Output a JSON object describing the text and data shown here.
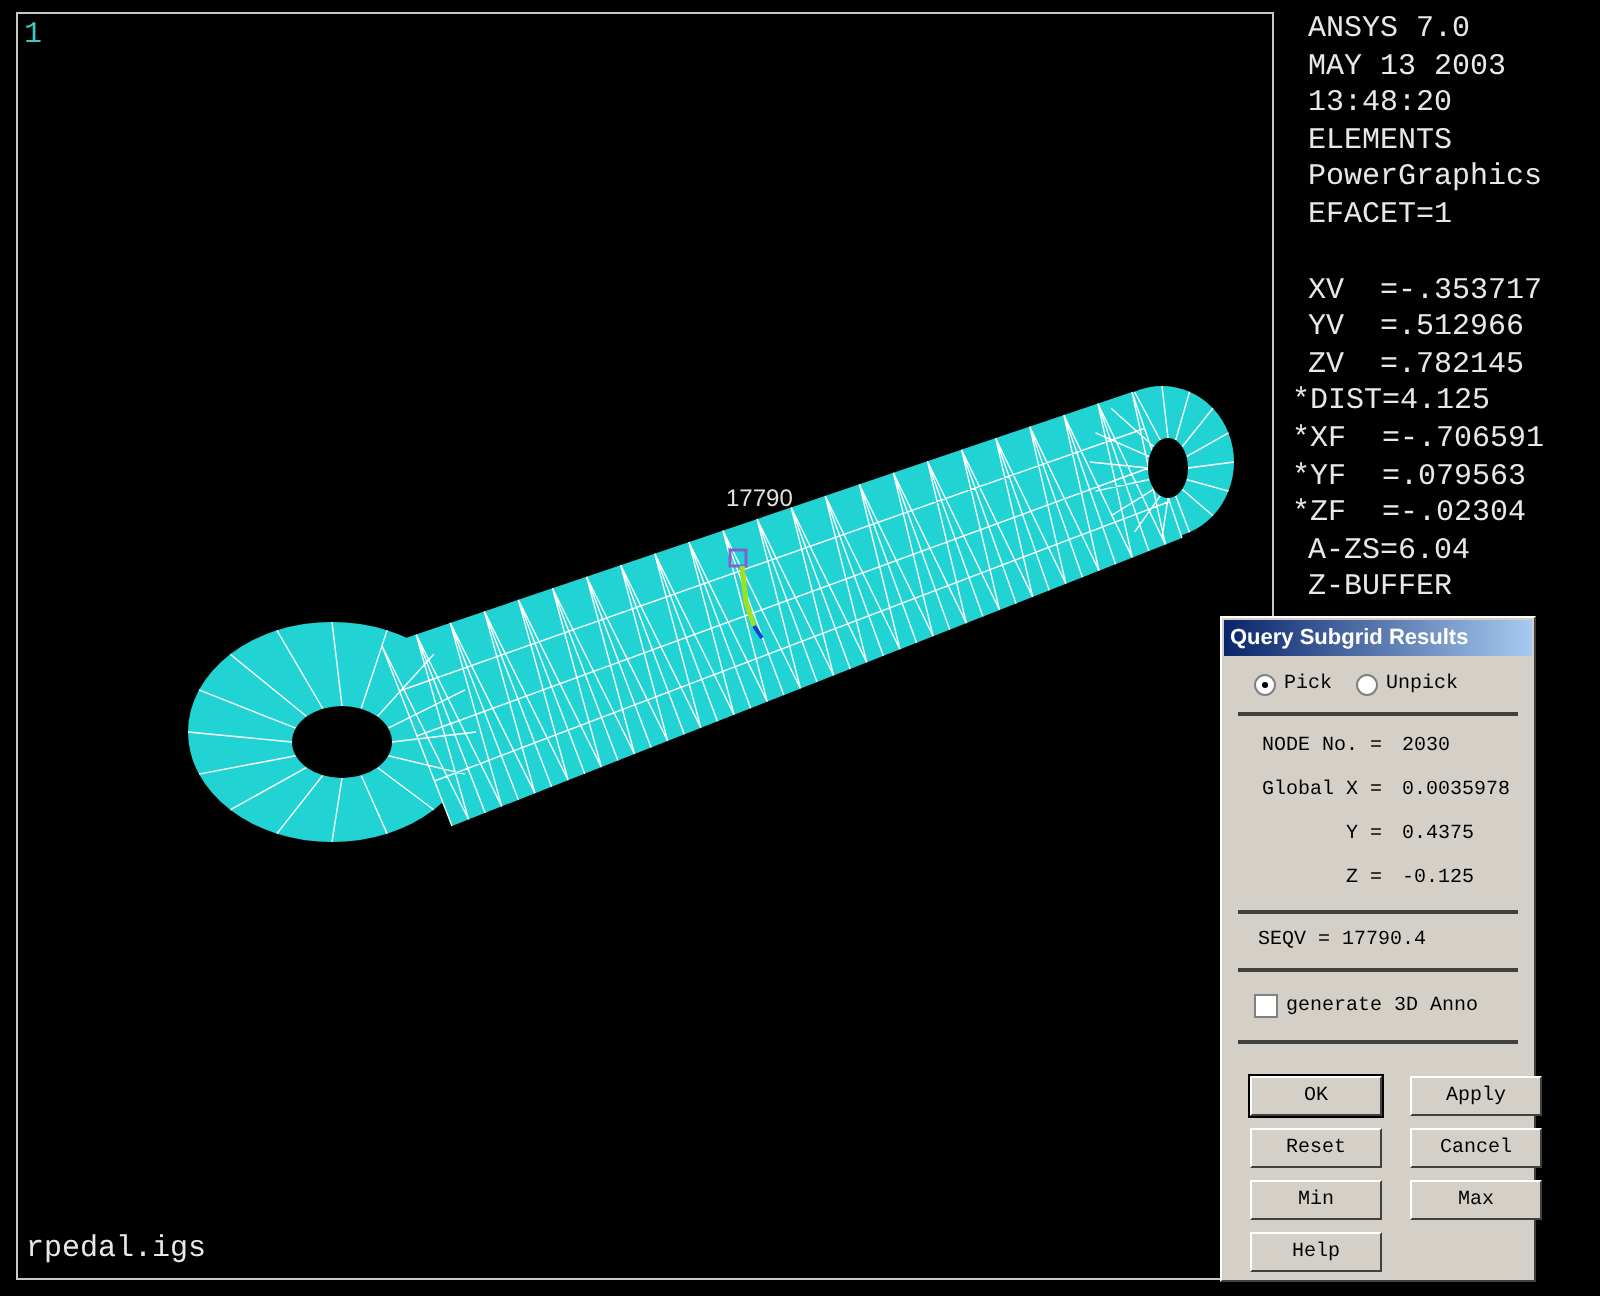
{
  "viewport": {
    "window_number": "1",
    "filename": "rpedal.igs",
    "node_label": "17790"
  },
  "info_blocks": [
    [
      {
        "text": "ANSYS 7.0",
        "kind": "plain"
      },
      {
        "text": "MAY 13 2003",
        "kind": "plain"
      },
      {
        "text": "13:48:20",
        "kind": "plain"
      },
      {
        "text": "ELEMENTS",
        "kind": "plain"
      },
      {
        "text": "PowerGraphics",
        "kind": "plain"
      },
      {
        "text": "EFACET=1",
        "kind": "plain"
      }
    ],
    [
      {
        "text": "XV  =-.353717",
        "kind": "plain"
      },
      {
        "text": "YV  =.512966",
        "kind": "plain"
      },
      {
        "text": "ZV  =.782145",
        "kind": "plain"
      },
      {
        "text": "*DIST=4.125",
        "kind": "starred"
      },
      {
        "text": "*XF  =-.706591",
        "kind": "starred"
      },
      {
        "text": "*YF  =.079563",
        "kind": "starred"
      },
      {
        "text": "*ZF  =-.02304",
        "kind": "starred"
      },
      {
        "text": "A-ZS=6.04",
        "kind": "plain"
      },
      {
        "text": "Z-BUFFER",
        "kind": "plain"
      }
    ]
  ],
  "dialog": {
    "title": "Query Subgrid Results",
    "modes": [
      {
        "label": "Pick",
        "selected": true
      },
      {
        "label": "Unpick",
        "selected": false
      }
    ],
    "fields": [
      {
        "label": "NODE No. =",
        "value": "2030"
      },
      {
        "label": "Global X =",
        "value": "0.0035978"
      },
      {
        "label": "Y =",
        "value": "0.4375"
      },
      {
        "label": "Z =",
        "value": "-0.125"
      }
    ],
    "result": "SEQV = 17790.4",
    "checkbox": {
      "label": "generate 3D Anno",
      "checked": false
    },
    "buttons": [
      {
        "label": "OK",
        "default": true
      },
      {
        "label": "Apply",
        "default": false
      },
      {
        "label": "Reset",
        "default": false
      },
      {
        "label": "Cancel",
        "default": false
      },
      {
        "label": "Min",
        "default": false
      },
      {
        "label": "Max",
        "default": false
      },
      {
        "label": "Help",
        "default": false
      }
    ]
  }
}
